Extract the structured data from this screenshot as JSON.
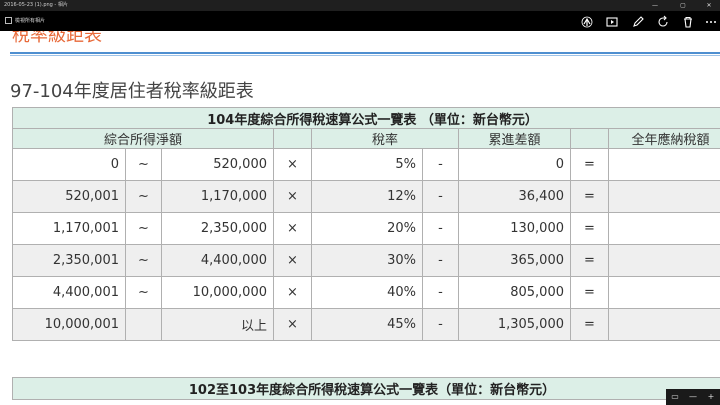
{
  "window": {
    "title": "2016-05-23 (1).png - 相片",
    "controls": [
      "—",
      "▢",
      "✕"
    ]
  },
  "toolbar": {
    "filename": "檢視所有相片",
    "tools": [
      "share-icon",
      "slideshow-icon",
      "edit-icon",
      "rotate-icon",
      "delete-icon",
      "more-icon"
    ]
  },
  "page": {
    "heading": "稅率級距表",
    "subtitle": "97-104年度居住者稅率級距表"
  },
  "table1": {
    "caption": "104年度綜合所得稅速算公式一覽表 （單位：新台幣元）",
    "headers": {
      "income": "綜合所得淨額",
      "rate": "稅率",
      "diff": "累進差額",
      "tax": "全年應納稅額"
    },
    "rows": [
      {
        "from": "0",
        "sep": "~",
        "to": "520,000",
        "x": "×",
        "rate": "5%",
        "minus": "-",
        "diff": "0",
        "eq": "="
      },
      {
        "from": "520,001",
        "sep": "~",
        "to": "1,170,000",
        "x": "×",
        "rate": "12%",
        "minus": "-",
        "diff": "36,400",
        "eq": "="
      },
      {
        "from": "1,170,001",
        "sep": "~",
        "to": "2,350,000",
        "x": "×",
        "rate": "20%",
        "minus": "-",
        "diff": "130,000",
        "eq": "="
      },
      {
        "from": "2,350,001",
        "sep": "~",
        "to": "4,400,000",
        "x": "×",
        "rate": "30%",
        "minus": "-",
        "diff": "365,000",
        "eq": "="
      },
      {
        "from": "4,400,001",
        "sep": "~",
        "to": "10,000,000",
        "x": "×",
        "rate": "40%",
        "minus": "-",
        "diff": "805,000",
        "eq": "="
      },
      {
        "from": "10,000,001",
        "sep": "",
        "to": "以上",
        "x": "×",
        "rate": "45%",
        "minus": "-",
        "diff": "1,305,000",
        "eq": "="
      }
    ]
  },
  "table2": {
    "caption": "102至103年度綜合所得稅速算公式一覽表（單位：新台幣元）"
  },
  "zoom": {
    "fit": "▭",
    "minus": "—",
    "plus": "+"
  }
}
